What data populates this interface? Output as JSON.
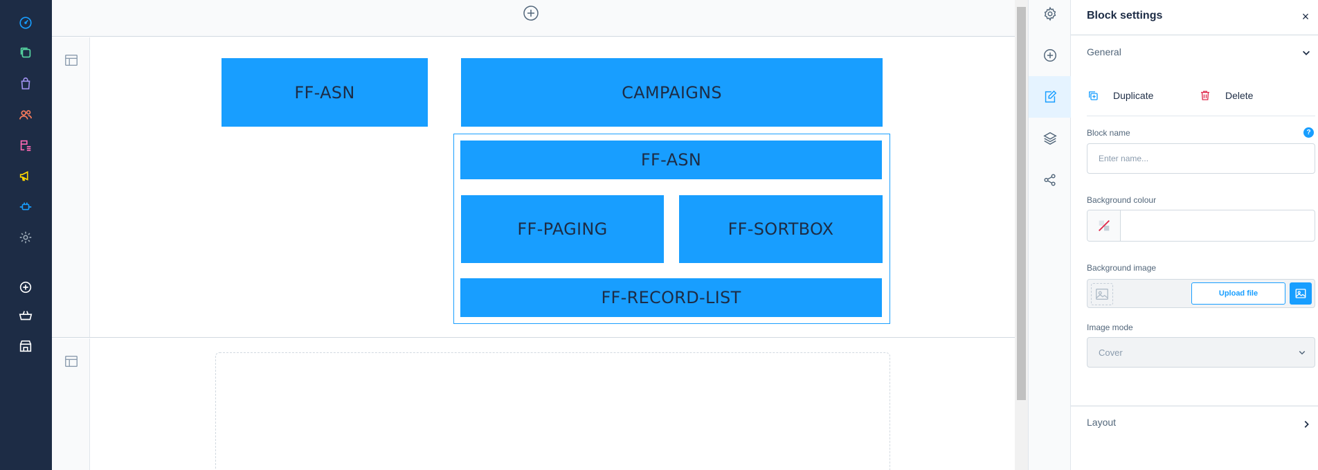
{
  "admin_menu": {
    "items": [
      {
        "icon": "dashboard-icon",
        "color": "#189eff"
      },
      {
        "icon": "catalogues-icon",
        "color": "#57d9a3"
      },
      {
        "icon": "orders-icon",
        "color": "#a092f0"
      },
      {
        "icon": "customers-icon",
        "color": "#ff7d5c"
      },
      {
        "icon": "content-icon",
        "color": "#ff68b4"
      },
      {
        "icon": "marketing-icon",
        "color": "#ffd700"
      },
      {
        "icon": "extensions-icon",
        "color": "#189eff"
      },
      {
        "icon": "settings-icon",
        "color": "#9aa8b5"
      },
      {
        "icon": "add-icon",
        "color": "#ffffff"
      },
      {
        "icon": "basket-icon",
        "color": "#ffffff"
      },
      {
        "icon": "store-icon",
        "color": "#ffffff"
      }
    ]
  },
  "canvas": {
    "section1": {
      "blocks": {
        "ff_asn_left": "FF-ASN",
        "campaigns": "CAMPAIGNS",
        "ff_asn": "FF-ASN",
        "ff_paging": "FF-PAGING",
        "ff_sortbox": "FF-SORTBOX",
        "ff_record_list": "FF-RECORD-LIST"
      }
    }
  },
  "panel": {
    "title": "Block settings",
    "general_label": "General",
    "duplicate_label": "Duplicate",
    "delete_label": "Delete",
    "block_name_label": "Block name",
    "block_name_placeholder": "Enter name...",
    "block_name_value": "",
    "help_glyph": "?",
    "background_colour_label": "Background colour",
    "background_image_label": "Background image",
    "upload_label": "Upload file",
    "image_mode_label": "Image mode",
    "image_mode_value": "Cover",
    "layout_label": "Layout",
    "close_glyph": "×"
  },
  "colors": {
    "accent": "#189eff",
    "sidebar_bg": "#1d2c45",
    "delete": "#de294c"
  }
}
